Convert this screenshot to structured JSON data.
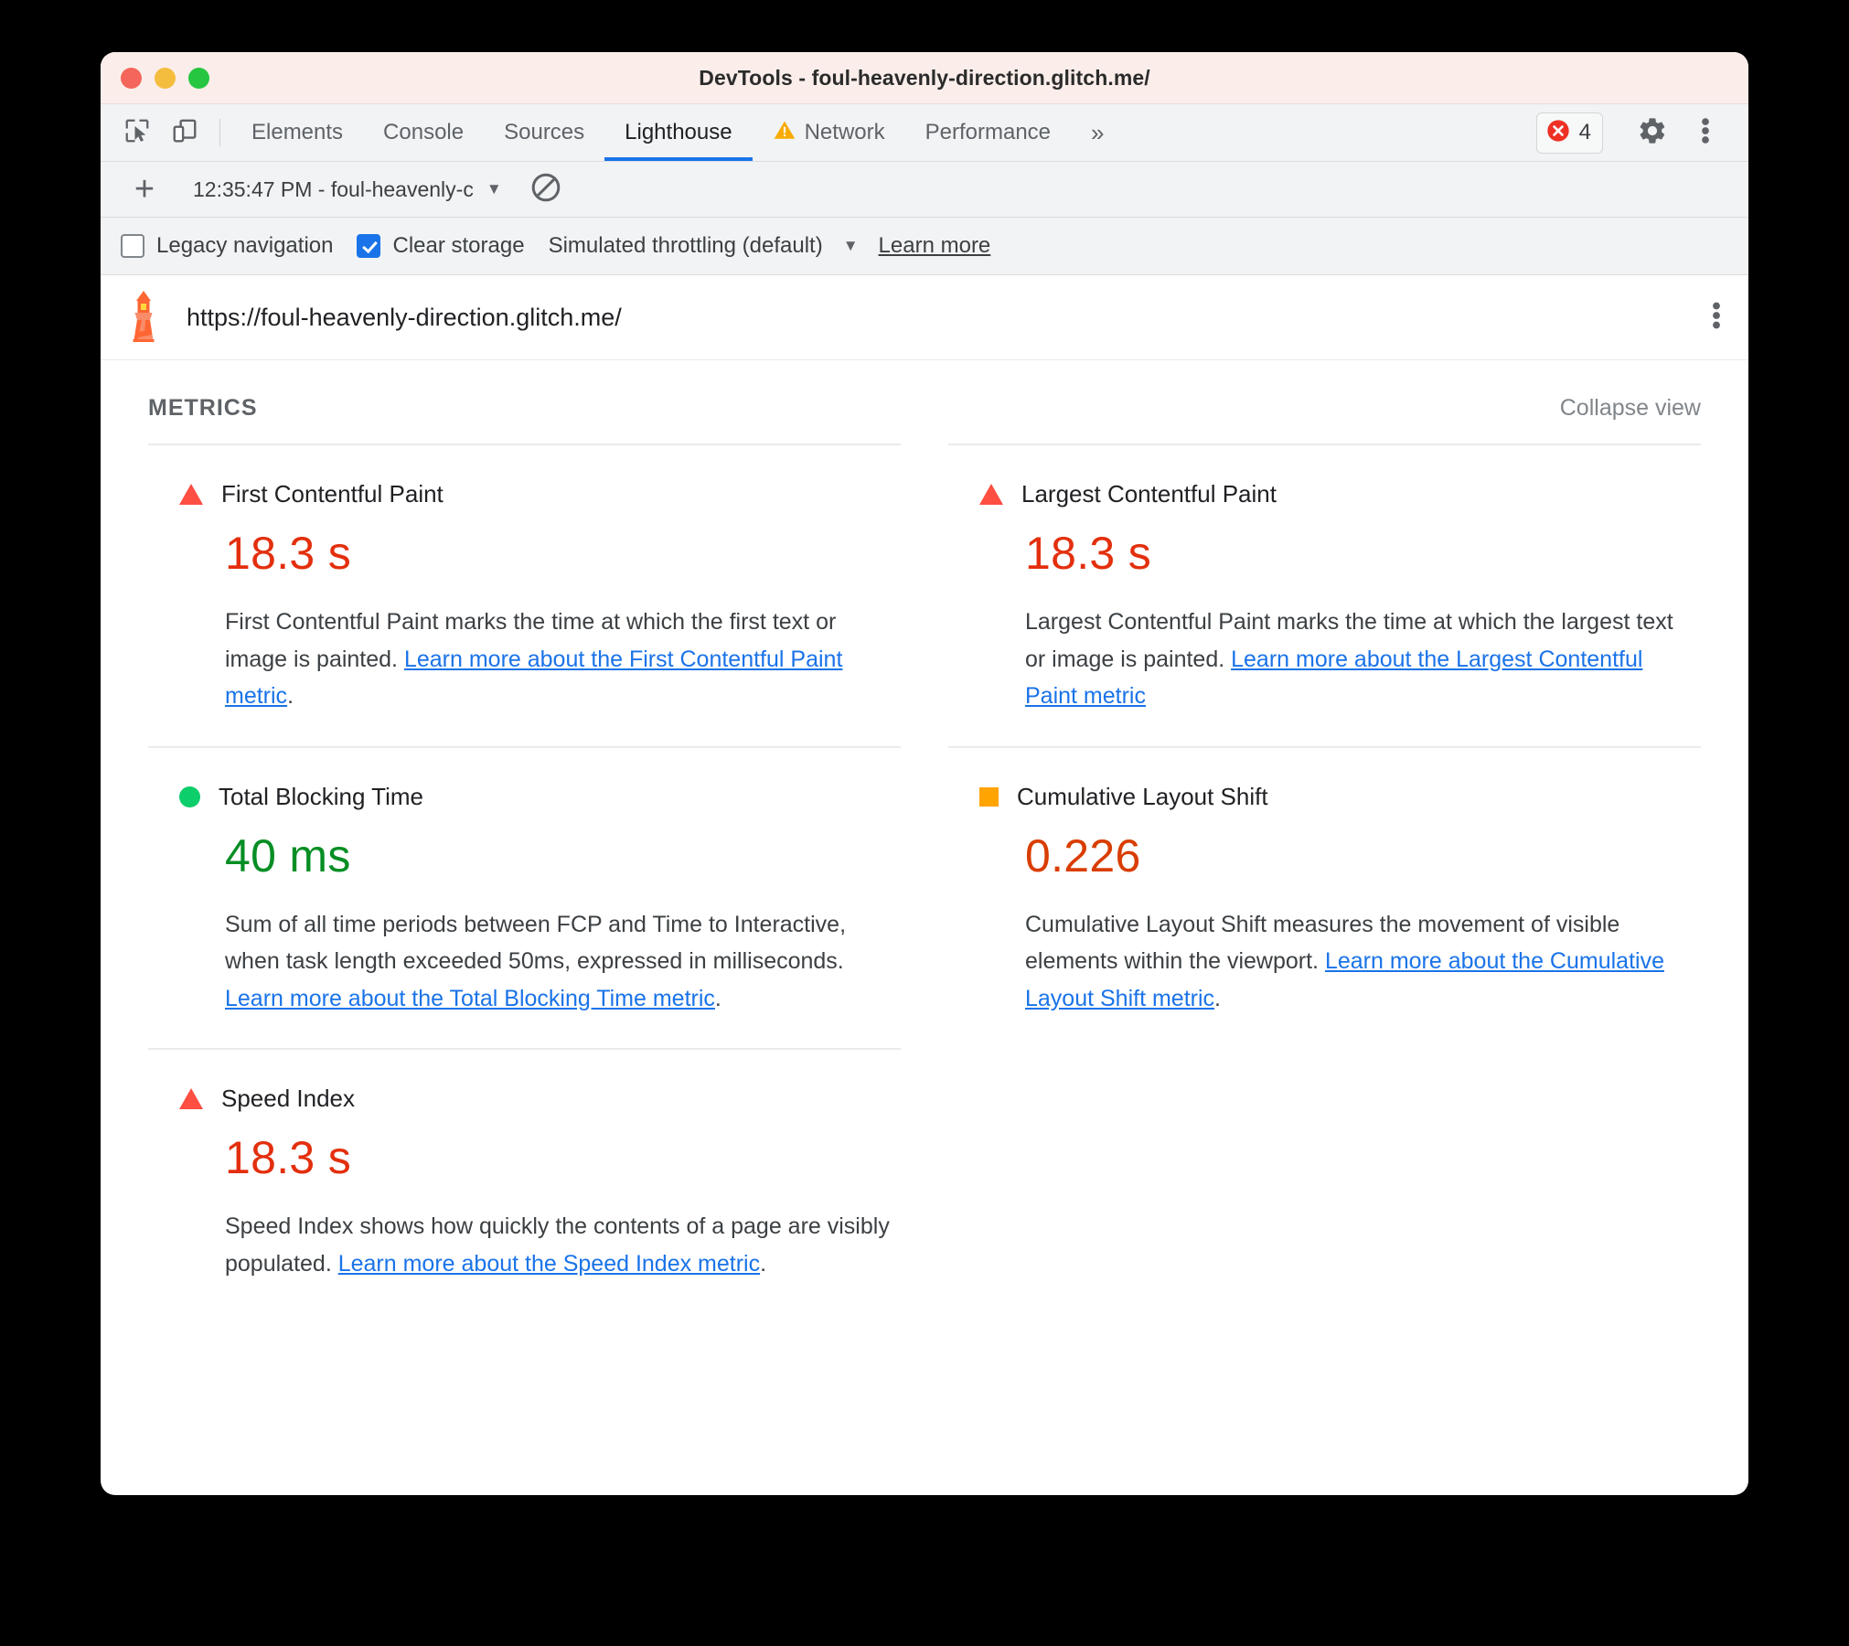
{
  "window": {
    "title": "DevTools - foul-heavenly-direction.glitch.me/"
  },
  "tabbar": {
    "inspect_icon": "inspect-cursor-icon",
    "device_icon": "device-toolbar-icon",
    "tabs": [
      {
        "label": "Elements",
        "selected": false,
        "warning": false
      },
      {
        "label": "Console",
        "selected": false,
        "warning": false
      },
      {
        "label": "Sources",
        "selected": false,
        "warning": false
      },
      {
        "label": "Lighthouse",
        "selected": true,
        "warning": false
      },
      {
        "label": "Network",
        "selected": false,
        "warning": true
      },
      {
        "label": "Performance",
        "selected": false,
        "warning": false
      }
    ],
    "more_tabs_glyph": "»",
    "error_count": "4",
    "settings_icon": "gear-icon",
    "more_icon": "three-dots-vertical-icon"
  },
  "runbar": {
    "add_label": "+",
    "selected_run": "12:35:47 PM - foul-heavenly-c",
    "caret": "▼",
    "clear_icon": "clear-all-icon"
  },
  "settings": {
    "legacy_navigation": {
      "label": "Legacy navigation",
      "checked": false
    },
    "clear_storage": {
      "label": "Clear storage",
      "checked": true
    },
    "throttling": {
      "label": "Simulated throttling (default)",
      "caret": "▼"
    },
    "learn_more": "Learn more"
  },
  "report": {
    "lighthouse_icon": "lighthouse-icon",
    "url": "https://foul-heavenly-direction.glitch.me/",
    "menu_icon": "three-dots-vertical-icon",
    "section_title": "METRICS",
    "collapse_view": "Collapse view"
  },
  "metrics": [
    {
      "id": "first-contentful-paint",
      "title": "First Contentful Paint",
      "value": "18.3 s",
      "rating": "fail",
      "marker": "triangle-fail-icon",
      "desc_before": "First Contentful Paint marks the time at which the first text or image is painted. ",
      "link_text": "Learn more about the First Contentful Paint metric",
      "desc_after": "."
    },
    {
      "id": "largest-contentful-paint",
      "title": "Largest Contentful Paint",
      "value": "18.3 s",
      "rating": "fail",
      "marker": "triangle-fail-icon",
      "desc_before": "Largest Contentful Paint marks the time at which the largest text or image is painted. ",
      "link_text": "Learn more about the Largest Contentful Paint metric",
      "desc_after": ""
    },
    {
      "id": "total-blocking-time",
      "title": "Total Blocking Time",
      "value": "40 ms",
      "rating": "pass",
      "marker": "circle-pass-icon",
      "desc_before": "Sum of all time periods between FCP and Time to Interactive, when task length exceeded 50ms, expressed in milliseconds. ",
      "link_text": "Learn more about the Total Blocking Time metric",
      "desc_after": "."
    },
    {
      "id": "cumulative-layout-shift",
      "title": "Cumulative Layout Shift",
      "value": "0.226",
      "rating": "average",
      "marker": "square-average-icon",
      "desc_before": "Cumulative Layout Shift measures the movement of visible elements within the viewport. ",
      "link_text": "Learn more about the Cumulative Layout Shift metric",
      "desc_after": "."
    },
    {
      "id": "speed-index",
      "title": "Speed Index",
      "value": "18.3 s",
      "rating": "fail",
      "marker": "triangle-fail-icon",
      "desc_before": "Speed Index shows how quickly the contents of a page are visibly populated. ",
      "link_text": "Learn more about the Speed Index metric",
      "desc_after": "."
    }
  ],
  "colors": {
    "fail": "#e32f0d",
    "pass": "#068e24",
    "average": "#d93d00",
    "marker_fail": "#ff4e42",
    "marker_pass": "#0cce6b",
    "marker_average": "#ffa400",
    "accent": "#1a73e8",
    "link": "#1a73e8"
  }
}
